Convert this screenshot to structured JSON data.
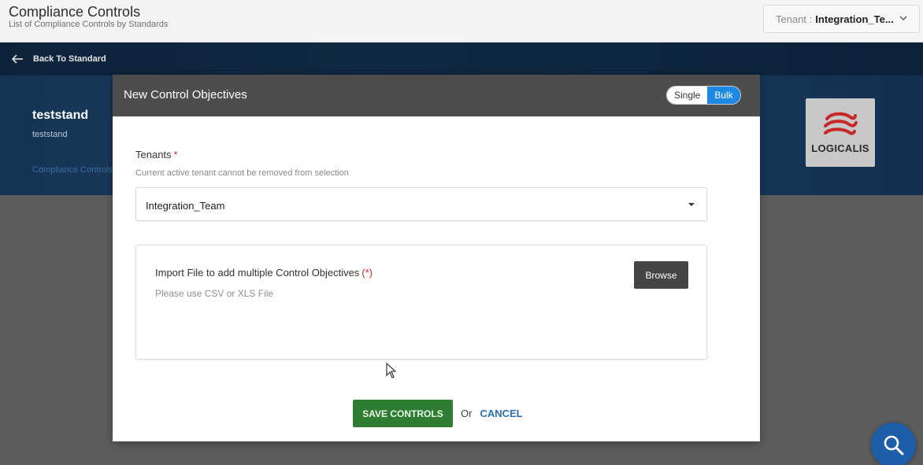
{
  "header": {
    "title": "Compliance Controls",
    "subtitle": "List of Compliance Controls by Standards",
    "tenant_prefix": "Tenant :",
    "tenant_value": "Integration_Te..."
  },
  "banner": {
    "back_label": "Back To Standard",
    "standard_name": "teststand",
    "standard_description": "teststand",
    "breadcrumb_link": "Compliance Controls",
    "logo_text": "LOGICALIS"
  },
  "modal": {
    "title": "New Control Objectives",
    "mode_options": [
      "Single",
      "Bulk"
    ],
    "active_mode": "Bulk",
    "tenants_label": "Tenants",
    "required_star": "*",
    "tenants_help": "Current active tenant cannot be removed from selection",
    "tenants_value": "Integration_Team",
    "import_title": "Import File to add multiple Control Objectives",
    "import_required": "(*)",
    "import_hint": "Please use CSV or XLS File",
    "browse_label": "Browse",
    "save_label": "SAVE CONTROLS",
    "or_label": "Or",
    "cancel_label": "CANCEL"
  },
  "colors": {
    "save_green": "#2e7d32",
    "bulk_blue": "#1e88e5",
    "cancel_blue": "#2a6fb0",
    "required_red": "#c62828"
  },
  "icons": {
    "back": "arrow-left-icon",
    "tenant_chevron": "chevron-down-icon",
    "dropdown_caret": "caret-down-icon",
    "fab": "search-icon"
  }
}
